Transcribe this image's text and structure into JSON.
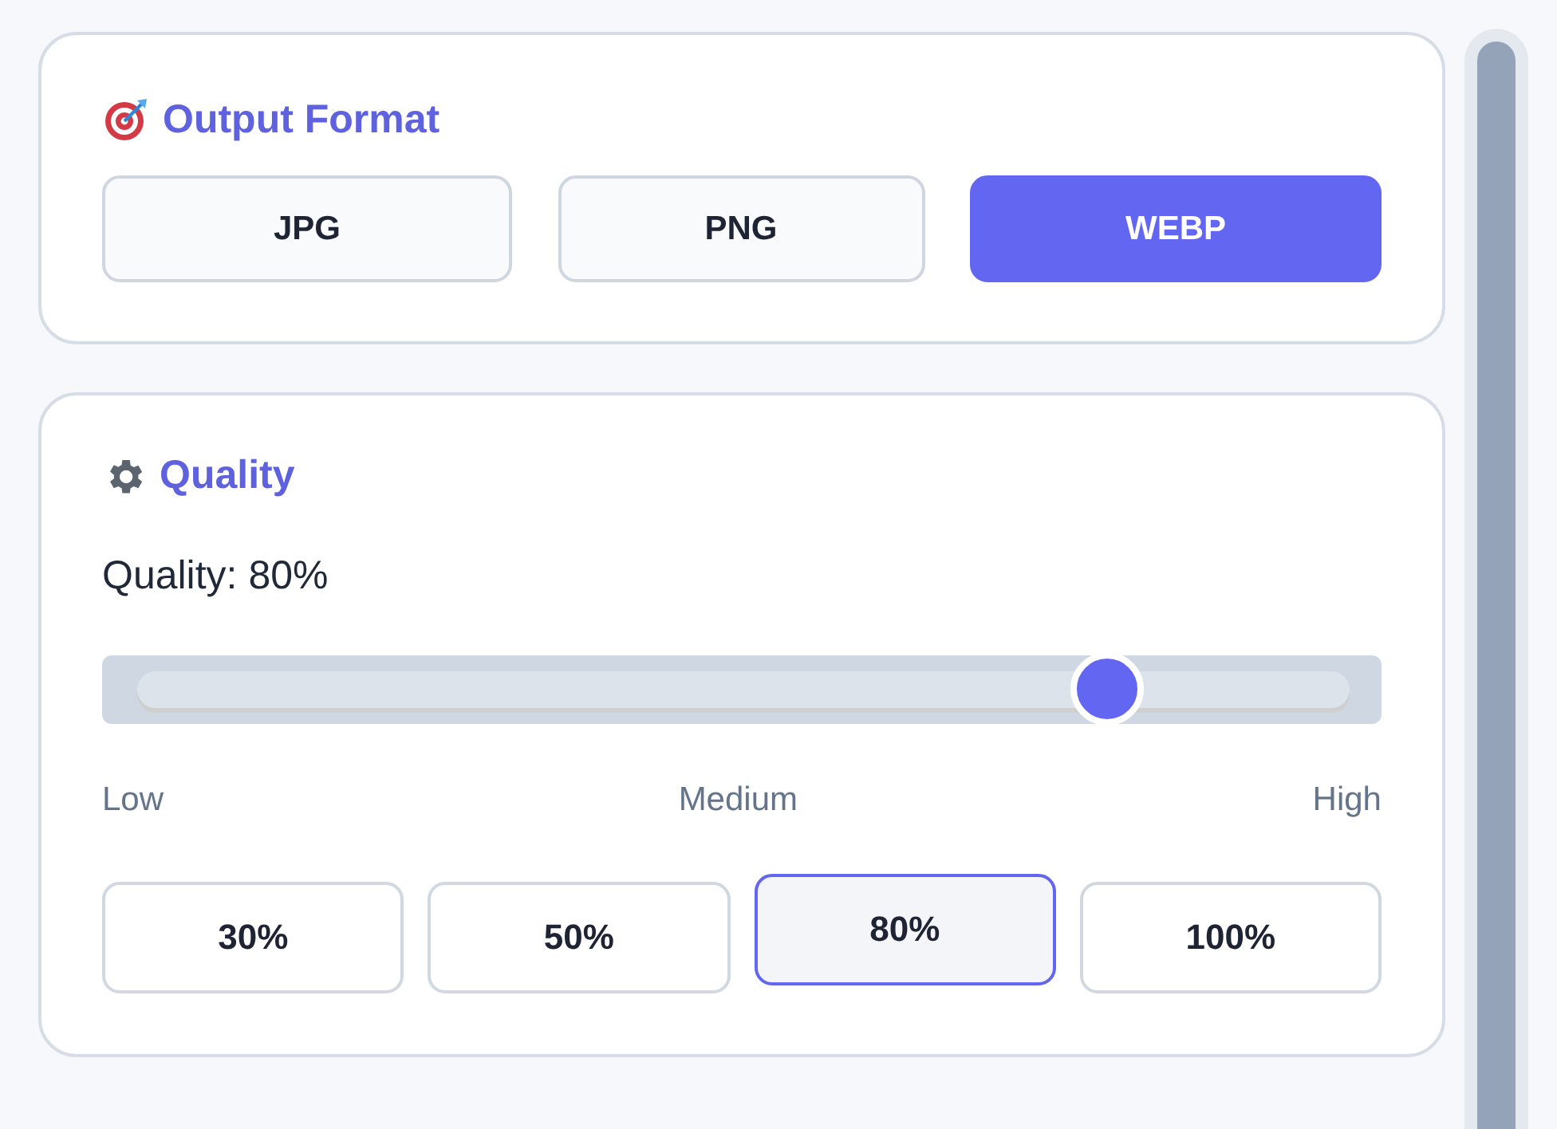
{
  "output_format": {
    "title": "Output Format",
    "options": [
      {
        "label": "JPG",
        "selected": false
      },
      {
        "label": "PNG",
        "selected": false
      },
      {
        "label": "WEBP",
        "selected": true
      }
    ]
  },
  "quality": {
    "title": "Quality",
    "value_label": "Quality: 80%",
    "slider": {
      "level": 0.8
    },
    "scale_labels": [
      "Low",
      "Medium",
      "High"
    ],
    "presets": [
      {
        "label": "30%",
        "selected": false
      },
      {
        "label": "50%",
        "selected": false
      },
      {
        "label": "80%",
        "selected": true
      },
      {
        "label": "100%",
        "selected": false
      }
    ]
  }
}
